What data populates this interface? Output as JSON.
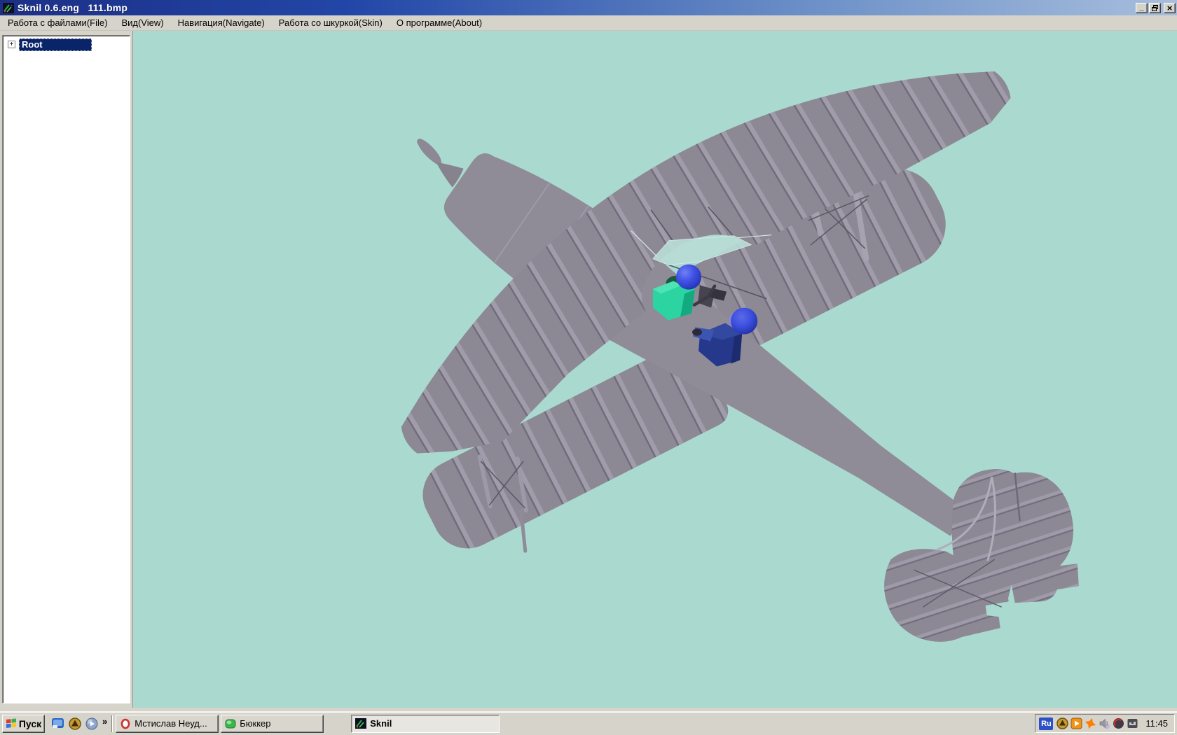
{
  "window": {
    "icon": "sknil-app-icon",
    "title": "Sknil 0.6.eng   111.bmp",
    "controls": {
      "minimize": "_",
      "restore": "restore",
      "close": "×"
    }
  },
  "menubar": {
    "items": [
      "Работа с файлами(File)",
      "Вид(View)",
      "Навигация(Navigate)",
      "Работа со шкуркой(Skin)",
      "О программе(About)"
    ]
  },
  "sidebar": {
    "tree": [
      {
        "label": "Root",
        "expand_glyph": "+",
        "selected": true
      }
    ]
  },
  "viewport": {
    "model": "biplane-3d-model-with-two-pilots",
    "background_color": "#aad9cf",
    "model_color": "#8c8894",
    "rib_light_color": "#a3a0ae",
    "rib_dark_color": "#6b6776",
    "windscreen_color": "#b9dcd6",
    "front_pilot_color": "#2bd4a1",
    "rear_pilot_color": "#26388c",
    "pilot_head_color": "#4254e8"
  },
  "taskbar": {
    "start_label": "Пуск",
    "quick_launch": [
      "show-desktop",
      "daemon-tools",
      "media-player"
    ],
    "overflow_chevron": "»",
    "buttons": [
      {
        "label": "Мстислав Неуд...",
        "icon": "opera"
      },
      {
        "label": "Бюккер",
        "icon": "bukker-app"
      },
      {
        "label": "Sknil",
        "icon": "sknil-app",
        "active": true
      }
    ],
    "tray": {
      "language_indicator": "Ru",
      "icons": [
        "daemon-tools",
        "media-play",
        "avast-antivirus",
        "volume",
        "antivirus-ball",
        "system-utility"
      ],
      "clock": "11:45"
    }
  }
}
